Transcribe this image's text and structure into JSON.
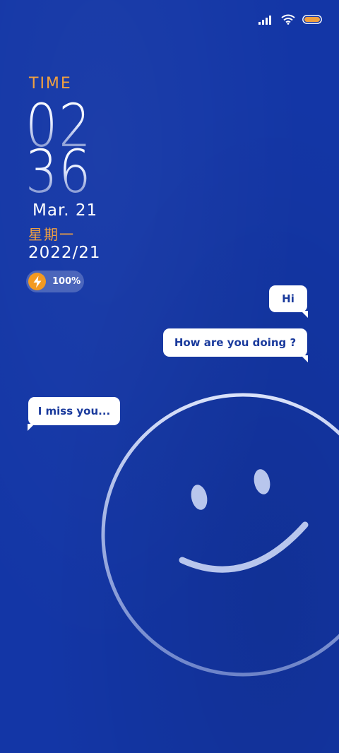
{
  "status_bar": {
    "signal_icon": "signal-bars-icon",
    "wifi_icon": "wifi-icon",
    "battery_icon": "battery-icon"
  },
  "lock_screen": {
    "time_label": "TIME",
    "hour": "02",
    "minute": "36",
    "date": "Mar. 21",
    "weekday": "星期一",
    "year_line": "2022/21",
    "battery_percent": "100%",
    "battery_level": 1.0
  },
  "messages": [
    {
      "text": "Hi",
      "side": "right"
    },
    {
      "text": "How are you doing ?",
      "side": "right"
    },
    {
      "text": "I miss you...",
      "side": "left"
    }
  ],
  "colors": {
    "background": "#1336a6",
    "accent_orange": "#f0a040",
    "bubble_bg": "#ffffff",
    "bubble_text": "#1a3a9c",
    "smiley_stroke": "#c8d4f4"
  },
  "decoration": {
    "smiley_icon": "smiley-face-icon"
  }
}
